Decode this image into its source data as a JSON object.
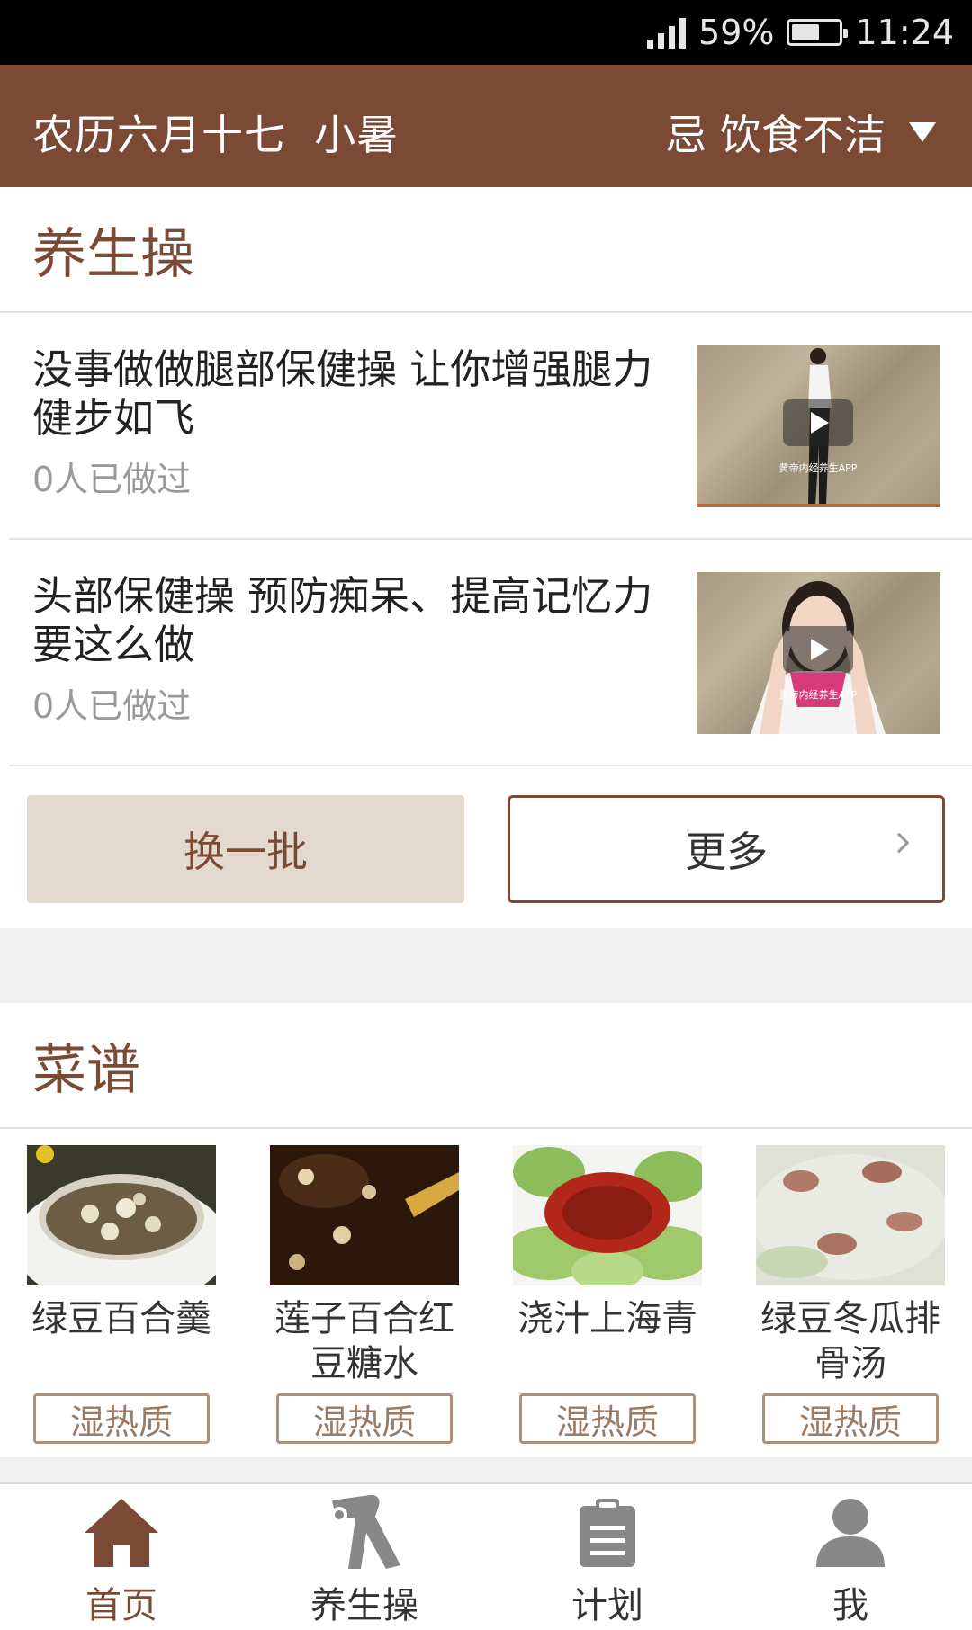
{
  "status_bar": {
    "battery": "59%",
    "battery_level": 0.59,
    "time": "11:24"
  },
  "header": {
    "lunar_date": "农历六月十七  小暑",
    "taboo": "忌 饮食不洁"
  },
  "exercise_section": {
    "title": "养生操",
    "items": [
      {
        "title": "没事做做腿部保健操 让你增强腿力健步如飞",
        "count": "0人已做过",
        "watermark": "黄帝内经养生APP"
      },
      {
        "title": "头部保健操 预防痴呆、提高记忆力要这么做",
        "count": "0人已做过",
        "watermark": "黄帝内经养生APP"
      }
    ],
    "swap_label": "换一批",
    "more_label": "更多"
  },
  "recipe_section": {
    "title": "菜谱",
    "items": [
      {
        "name": "绿豆百合羹",
        "tag": "湿热质"
      },
      {
        "name": "莲子百合红豆糖水",
        "tag": "湿热质"
      },
      {
        "name": "浇汁上海青",
        "tag": "湿热质"
      },
      {
        "name": "绿豆冬瓜排骨汤",
        "tag": "湿热质"
      }
    ]
  },
  "tabbar": {
    "tabs": [
      {
        "label": "首页",
        "icon": "home-icon",
        "active": true
      },
      {
        "label": "养生操",
        "icon": "exercise-icon",
        "active": false
      },
      {
        "label": "计划",
        "icon": "clipboard-icon",
        "active": false
      },
      {
        "label": "我",
        "icon": "person-icon",
        "active": false
      }
    ]
  },
  "colors": {
    "brand": "#7b4a35",
    "swap_bg": "#e3d9cf",
    "tag_border": "#b09075"
  }
}
